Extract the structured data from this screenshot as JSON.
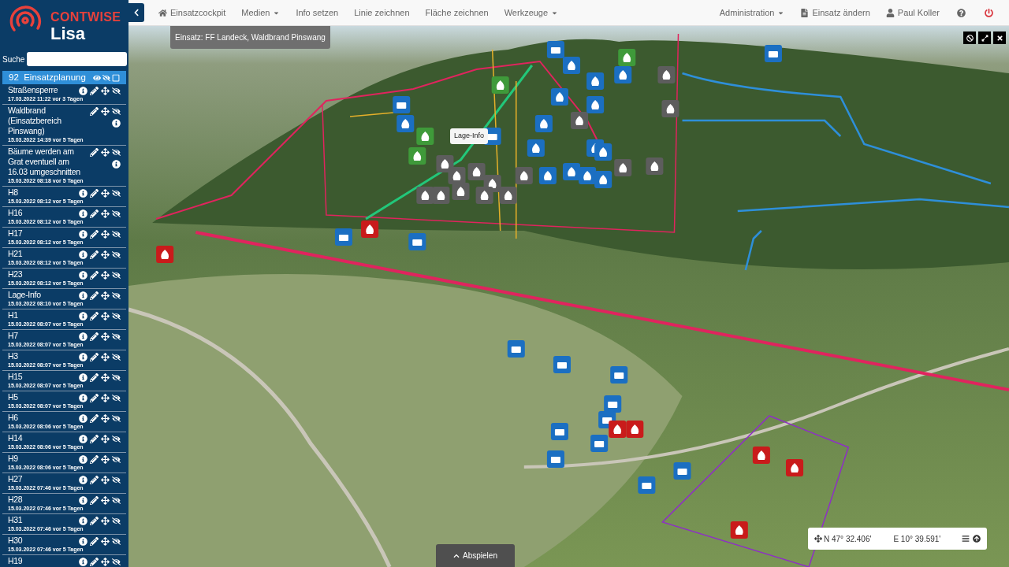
{
  "brand": {
    "company": "CONTWISE",
    "product": "Lisa"
  },
  "search": {
    "label": "Suche"
  },
  "sidebar": {
    "header": {
      "count": "92",
      "title": "Einsatzplanung",
      "selected": true
    },
    "items": [
      {
        "title": "Straßensperre",
        "date": "17.03.2022 11:22 vor 3 Tagen",
        "kind": "inline"
      },
      {
        "title": "Waldbrand (Einsatzbereich Pinswang)",
        "date": "15.03.2022 14:39 vor 5 Tagen",
        "kind": "wrapped"
      },
      {
        "title": "Bäume werden am Grat eventuell am 16.03 umgeschnitten",
        "date": "15.03.2022 08:18 vor 5 Tagen",
        "kind": "wrapped"
      },
      {
        "title": "H8",
        "date": "15.03.2022 08:12 vor 5 Tagen",
        "kind": "inline"
      },
      {
        "title": "H16",
        "date": "15.03.2022 08:12 vor 5 Tagen",
        "kind": "inline"
      },
      {
        "title": "H17",
        "date": "15.03.2022 08:12 vor 5 Tagen",
        "kind": "inline"
      },
      {
        "title": "H21",
        "date": "15.03.2022 08:12 vor 5 Tagen",
        "kind": "inline"
      },
      {
        "title": "H23",
        "date": "15.03.2022 08:12 vor 5 Tagen",
        "kind": "inline"
      },
      {
        "title": "Lage-Info",
        "date": "15.03.2022 08:10 vor 5 Tagen",
        "kind": "inline"
      },
      {
        "title": "H1",
        "date": "15.03.2022 08:07 vor 5 Tagen",
        "kind": "inline"
      },
      {
        "title": "H7",
        "date": "15.03.2022 08:07 vor 5 Tagen",
        "kind": "inline"
      },
      {
        "title": "H3",
        "date": "15.03.2022 08:07 vor 5 Tagen",
        "kind": "inline"
      },
      {
        "title": "H15",
        "date": "15.03.2022 08:07 vor 5 Tagen",
        "kind": "inline"
      },
      {
        "title": "H5",
        "date": "15.03.2022 08:07 vor 5 Tagen",
        "kind": "inline"
      },
      {
        "title": "H6",
        "date": "15.03.2022 08:06 vor 5 Tagen",
        "kind": "inline"
      },
      {
        "title": "H14",
        "date": "15.03.2022 08:06 vor 5 Tagen",
        "kind": "inline"
      },
      {
        "title": "H9",
        "date": "15.03.2022 08:06 vor 5 Tagen",
        "kind": "inline"
      },
      {
        "title": "H27",
        "date": "15.03.2022 07:46 vor 5 Tagen",
        "kind": "inline"
      },
      {
        "title": "H28",
        "date": "15.03.2022 07:46 vor 5 Tagen",
        "kind": "inline"
      },
      {
        "title": "H31",
        "date": "15.03.2022 07:46 vor 5 Tagen",
        "kind": "inline"
      },
      {
        "title": "H30",
        "date": "15.03.2022 07:46 vor 5 Tagen",
        "kind": "inline"
      },
      {
        "title": "H19",
        "kind": "inline"
      }
    ]
  },
  "nav": {
    "left": [
      {
        "label": "Einsatzcockpit",
        "kind": "home"
      },
      {
        "label": "Medien",
        "kind": "dropdown"
      },
      {
        "label": "Info setzen",
        "kind": "plain"
      },
      {
        "label": "Linie zeichnen",
        "kind": "plain"
      },
      {
        "label": "Fläche zeichnen",
        "kind": "plain"
      },
      {
        "label": "Werkzeuge",
        "kind": "dropdown"
      }
    ],
    "right": [
      {
        "label": "Administration",
        "kind": "dropdown"
      },
      {
        "label": "Einsatz ändern",
        "kind": "document"
      },
      {
        "label": "Paul Koller",
        "kind": "user"
      }
    ]
  },
  "map": {
    "mission": "Einsatz: FF Landeck, Waldbrand Pinswang",
    "tooltip": "Lage-Info",
    "coords": {
      "north": "N 47° 32.406'",
      "east": "E 10° 39.591'"
    },
    "play": "Abspielen"
  }
}
